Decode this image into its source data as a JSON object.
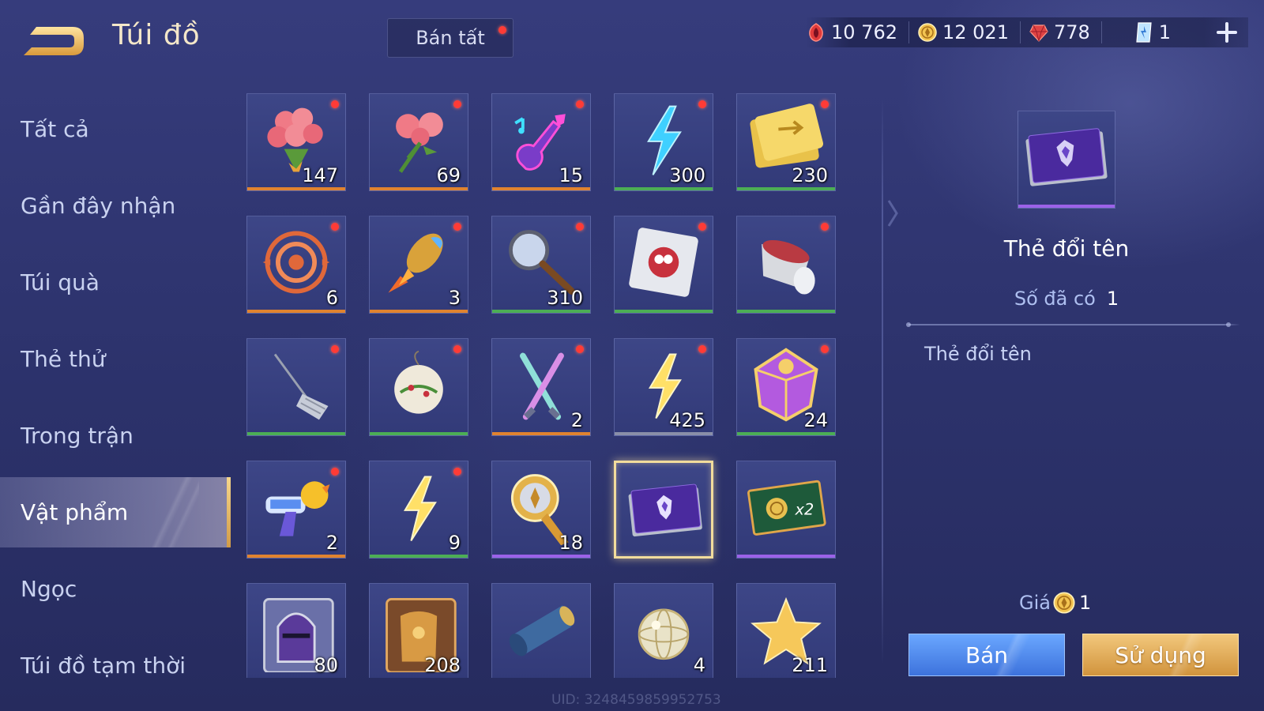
{
  "header": {
    "title": "Túi đồ",
    "sell_all_label": "Bán tất"
  },
  "currencies": [
    {
      "icon": "red-gem-icon",
      "value": "10 762"
    },
    {
      "icon": "gold-coin-icon",
      "value": "12 021"
    },
    {
      "icon": "ruby-icon",
      "value": "778"
    },
    {
      "icon": "blue-card-icon",
      "value": "1"
    }
  ],
  "sidebar": {
    "items": [
      {
        "label": "Tất cả"
      },
      {
        "label": "Gần đây nhận"
      },
      {
        "label": "Túi quà"
      },
      {
        "label": "Thẻ thử"
      },
      {
        "label": "Trong trận"
      },
      {
        "label": "Vật phẩm",
        "active": true
      },
      {
        "label": "Ngọc"
      },
      {
        "label": "Túi đồ tạm thời"
      }
    ]
  },
  "inventory": {
    "items": [
      {
        "icon": "rose-bouquet-icon",
        "count": "147",
        "rarity": "orange",
        "new": true
      },
      {
        "icon": "roses-icon",
        "count": "69",
        "rarity": "orange",
        "new": true
      },
      {
        "icon": "neon-guitar-icon",
        "count": "15",
        "rarity": "orange",
        "new": true
      },
      {
        "icon": "blue-lightning-icon",
        "count": "300",
        "rarity": "green",
        "new": true
      },
      {
        "icon": "golden-ticket-icon",
        "count": "230",
        "rarity": "green",
        "new": true
      },
      {
        "icon": "swirl-emblem-icon",
        "count": "6",
        "rarity": "orange",
        "new": true
      },
      {
        "icon": "firework-rocket-icon",
        "count": "3",
        "rarity": "orange",
        "new": true
      },
      {
        "icon": "magnifier-icon",
        "count": "310",
        "rarity": "green",
        "new": true
      },
      {
        "icon": "sticker-pack-icon",
        "count": "",
        "rarity": "green",
        "new": true
      },
      {
        "icon": "paper-cup-icon",
        "count": "",
        "rarity": "green",
        "new": true
      },
      {
        "icon": "broom-icon",
        "count": "",
        "rarity": "green",
        "new": true
      },
      {
        "icon": "ornament-ball-icon",
        "count": "",
        "rarity": "green",
        "new": true
      },
      {
        "icon": "crossed-wands-icon",
        "count": "2",
        "rarity": "orange",
        "new": true
      },
      {
        "icon": "yellow-lightning-icon",
        "count": "425",
        "rarity": "gray",
        "new": true
      },
      {
        "icon": "purple-dice-icon",
        "count": "24",
        "rarity": "green",
        "new": true
      },
      {
        "icon": "water-gun-icon",
        "count": "2",
        "rarity": "orange",
        "new": true
      },
      {
        "icon": "yellow-lightning-icon",
        "count": "9",
        "rarity": "green",
        "new": true
      },
      {
        "icon": "golden-horn-icon",
        "count": "18",
        "rarity": "purple",
        "new": false
      },
      {
        "icon": "rename-card-icon",
        "count": "",
        "rarity": "none",
        "new": false,
        "selected": true
      },
      {
        "icon": "x2-coin-card-icon",
        "count": "",
        "rarity": "purple",
        "new": false
      },
      {
        "icon": "knight-helmet-icon",
        "count": "80",
        "rarity": "none",
        "new": false
      },
      {
        "icon": "golden-armor-icon",
        "count": "208",
        "rarity": "none",
        "new": false
      },
      {
        "icon": "scroll-map-icon",
        "count": "",
        "rarity": "none",
        "new": false
      },
      {
        "icon": "crystal-orb-icon",
        "count": "4",
        "rarity": "none",
        "new": false
      },
      {
        "icon": "gold-star-icon",
        "count": "211",
        "rarity": "none",
        "new": false
      }
    ],
    "uid": "UID: 3248459859952753"
  },
  "detail": {
    "name": "Thẻ đổi tên",
    "owned_label": "Số đã có",
    "owned_value": "1",
    "description": "Thẻ đổi tên",
    "price_label": "Giá",
    "price_value": "1",
    "sell_label": "Bán",
    "use_label": "Sử dụng"
  },
  "colors": {
    "rarity_orange": "#e0832f",
    "rarity_green": "#4cae55",
    "rarity_purple": "#9b62e8",
    "rarity_gray": "#8a8fa8",
    "accent_gold": "#f2dc9c",
    "notify_red": "#ff3b36"
  }
}
